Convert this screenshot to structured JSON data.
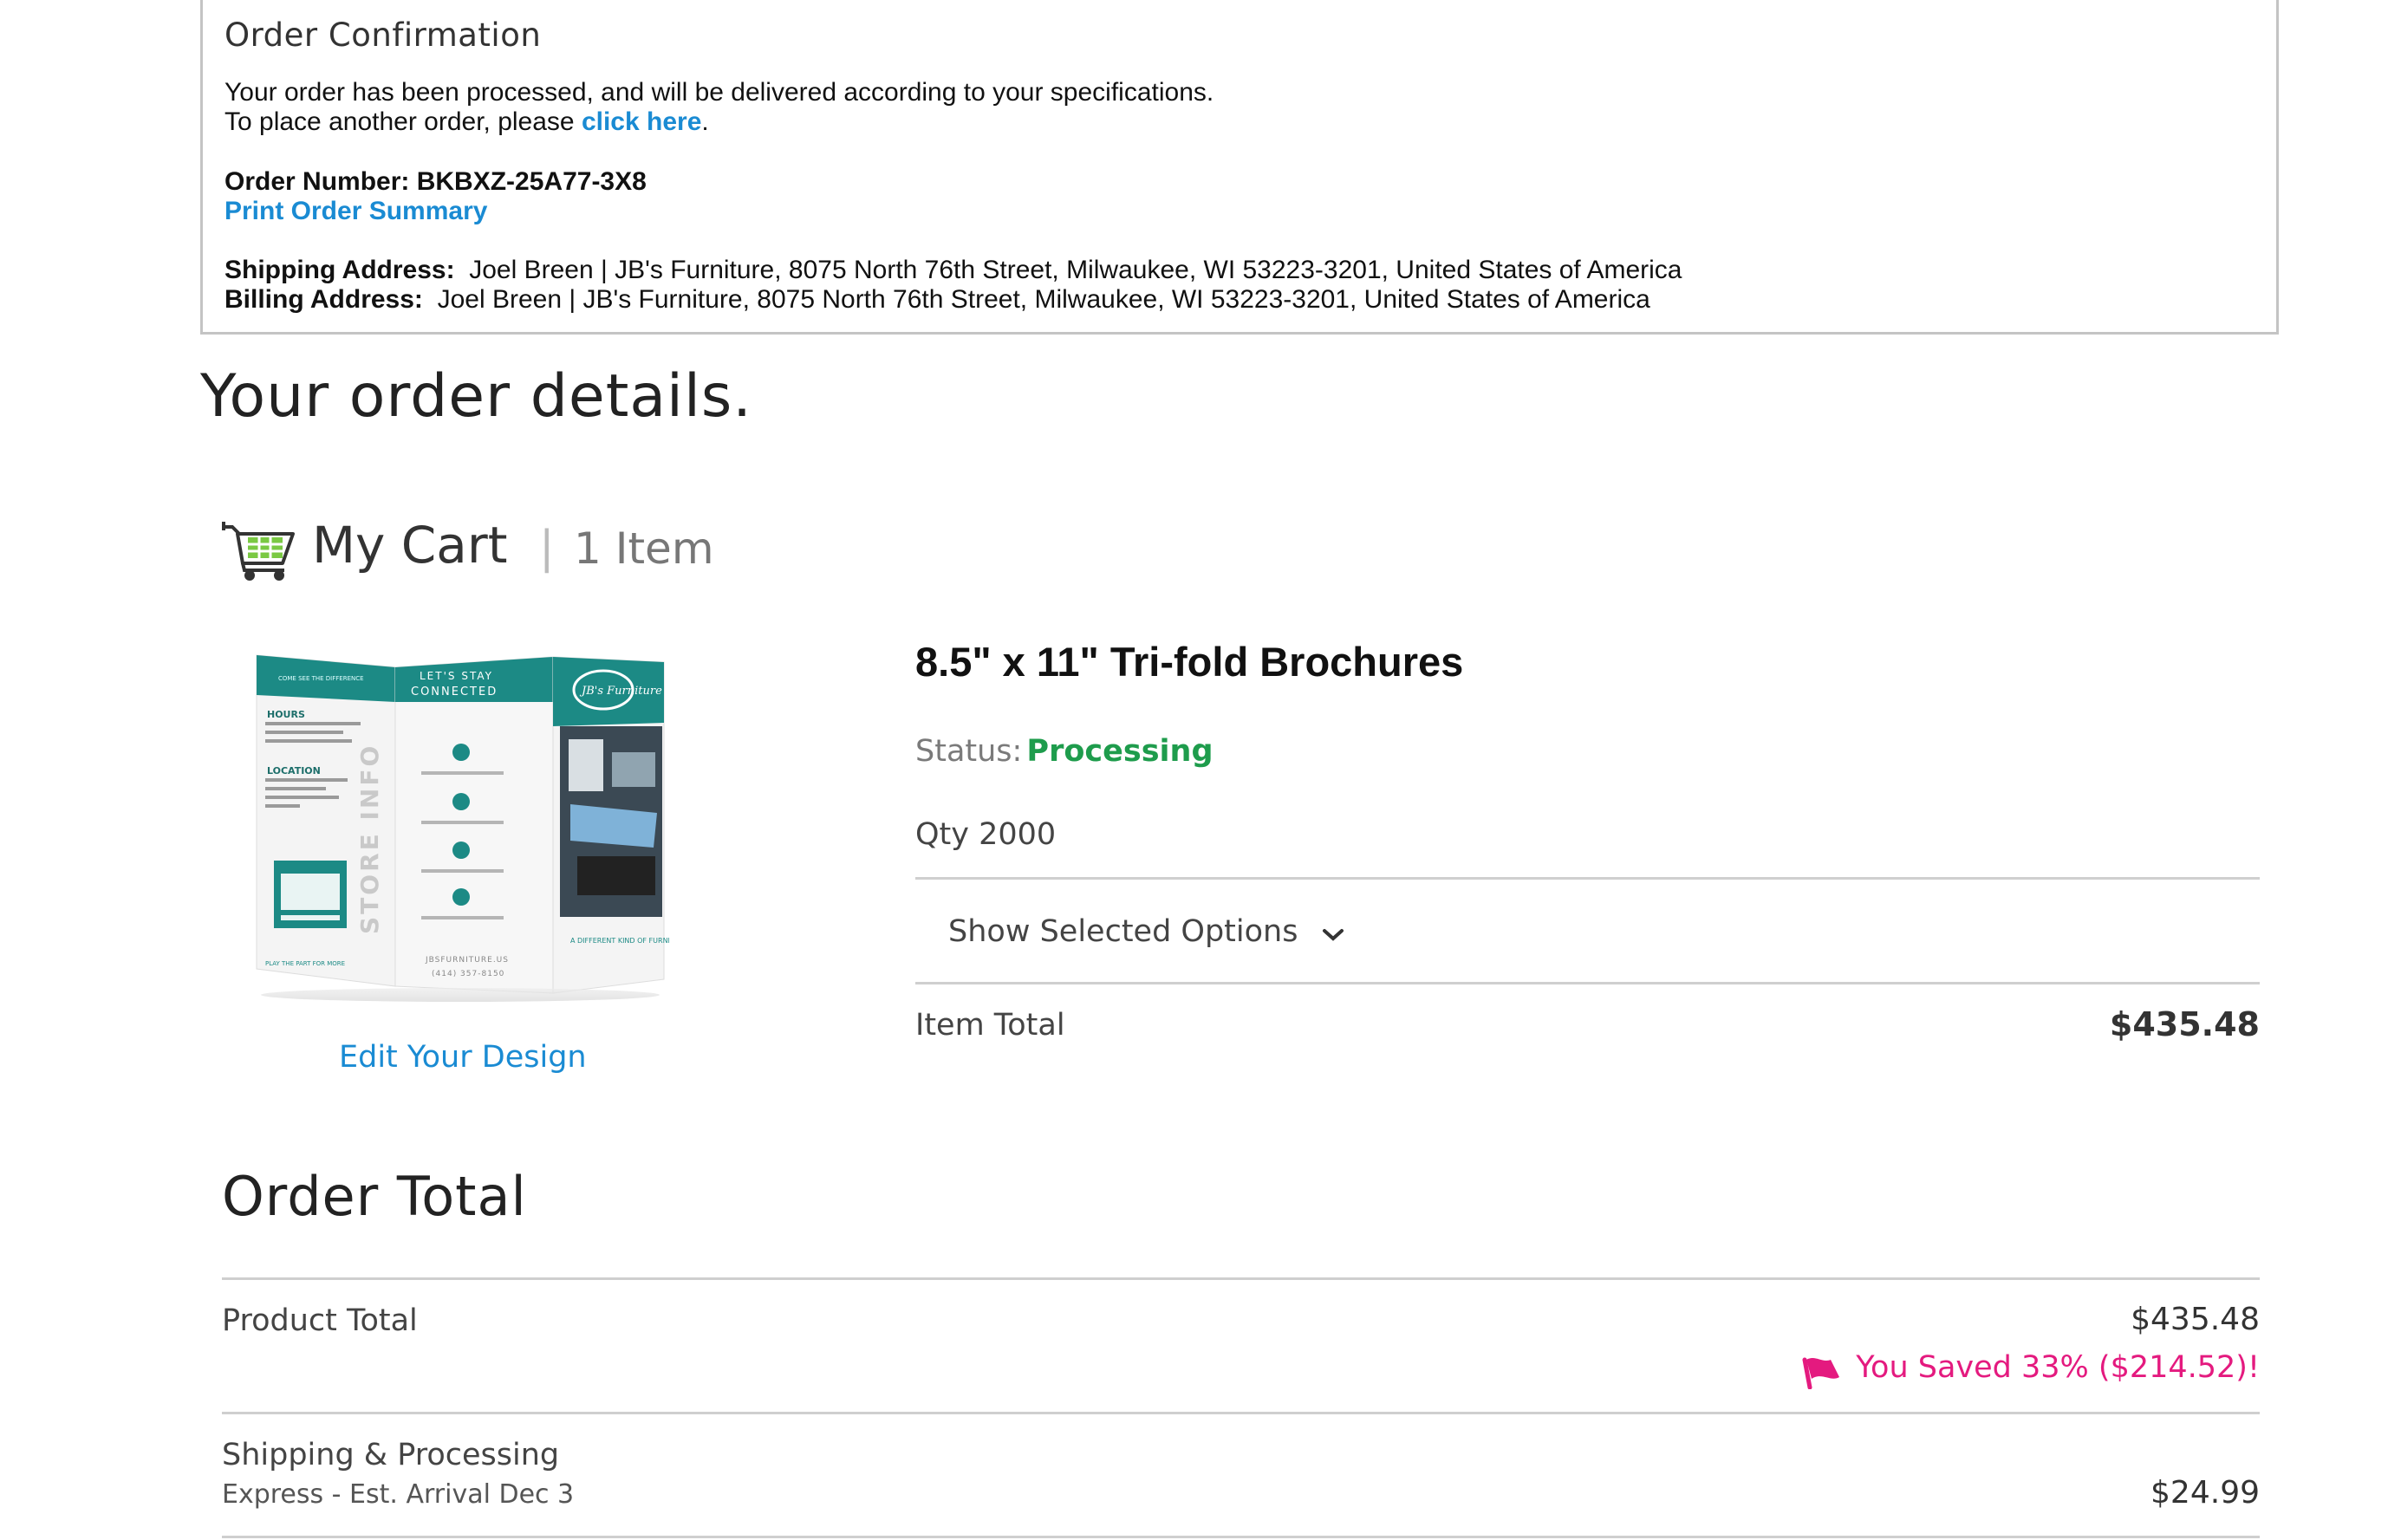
{
  "confirmation": {
    "title": "Order Confirmation",
    "line1": "Your order has been processed, and will be delivered according to your specifications.",
    "line2_prefix": "To place another order, please ",
    "line2_link": "click here",
    "line2_suffix": ".",
    "order_number_label": "Order Number:",
    "order_number": "BKBXZ-25A77-3X8",
    "print_link": "Print Order Summary",
    "shipping_label": "Shipping Address:",
    "shipping_value": "Joel Breen | JB's Furniture, 8075 North 76th Street, Milwaukee, WI 53223-3201, United States of America",
    "billing_label": "Billing Address:",
    "billing_value": "Joel Breen | JB's Furniture, 8075 North 76th Street, Milwaukee, WI 53223-3201, United States of America"
  },
  "details_heading": "Your order details.",
  "cart": {
    "title": "My Cart",
    "separator": "|",
    "count": "1 Item",
    "icon": "shopping-cart-icon"
  },
  "product": {
    "name": "8.5\" x 11\" Tri-fold Brochures",
    "status_label": "Status:",
    "status_value": "Processing",
    "qty": "Qty 2000",
    "options_label": "Show Selected Options",
    "item_total_label": "Item Total",
    "item_total": "$435.48",
    "edit_link": "Edit Your Design",
    "thumbnail": {
      "panel1_top": "COME SEE THE DIFFERENCE",
      "hours": "HOURS",
      "location": "LOCATION",
      "panel2_title": "LET'S STAY CONNECTED",
      "store_info": "STORE INFO",
      "brand": "JB's Furniture",
      "web": "JBSFURNITURE.US",
      "phone": "(414) 357-8150",
      "tagline": "A DIFFERENT KIND OF FURNITURE STORE",
      "footer_left": "PLAY THE PART FOR MORE"
    }
  },
  "order_total": {
    "heading": "Order Total",
    "product_total_label": "Product Total",
    "product_total": "$435.48",
    "saved_text": "You Saved 33% ($214.52)!",
    "shipping_label": "Shipping & Processing",
    "shipping_sub": "Express - Est. Arrival Dec 3",
    "shipping_price": "$24.99"
  },
  "colors": {
    "link": "#1a8bd3",
    "status": "#1e9c4c",
    "savings": "#e41a7f",
    "brochure_teal": "#1c8a85"
  }
}
